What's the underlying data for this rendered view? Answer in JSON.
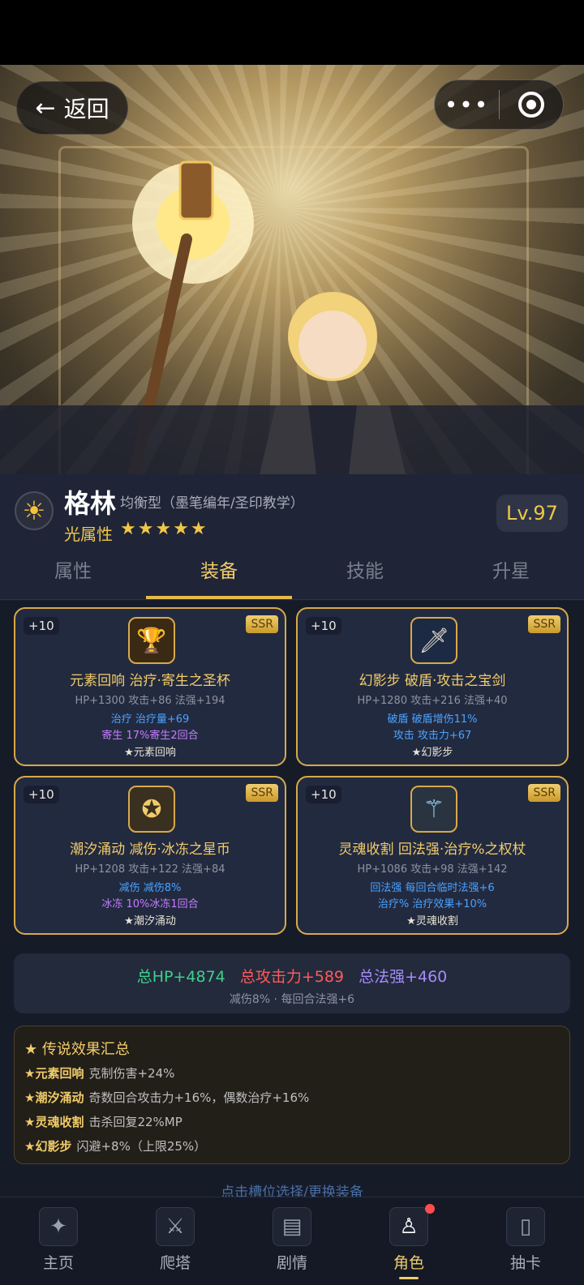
{
  "header": {
    "back_label": "返回",
    "more_dots": "•••"
  },
  "character": {
    "name": "格林",
    "subtype": "均衡型（墨笔编年/圣印教学）",
    "element": "光属性",
    "stars": "★★★★★",
    "level": "Lv.97"
  },
  "tabs": [
    "属性",
    "装备",
    "技能",
    "升星"
  ],
  "equipment": [
    {
      "plus": "+10",
      "rarity": "SSR",
      "title": "元素回响 治疗·寄生之圣杯",
      "stats": "HP+1300 攻击+86 法强+194",
      "fx1": "治疗 治疗量+69",
      "fx1_color": "#4aa3ff",
      "fx2": "寄生 17%寄生2回合",
      "fx2_color": "#c77dff",
      "legend": "★元素回响",
      "icon": "chalice-icon"
    },
    {
      "plus": "+10",
      "rarity": "SSR",
      "title": "幻影步 破盾·攻击之宝剑",
      "stats": "HP+1280 攻击+216 法强+40",
      "fx1": "破盾 破盾增伤11%",
      "fx1_color": "#4aa3ff",
      "fx2": "攻击 攻击力+67",
      "fx2_color": "#4aa3ff",
      "legend": "★幻影步",
      "icon": "sword-icon"
    },
    {
      "plus": "+10",
      "rarity": "SSR",
      "title": "潮汐涌动 减伤·冰冻之星币",
      "stats": "HP+1208 攻击+122 法强+84",
      "fx1": "减伤 减伤8%",
      "fx1_color": "#4aa3ff",
      "fx2": "冰冻 10%冰冻1回合",
      "fx2_color": "#c77dff",
      "legend": "★潮汐涌动",
      "icon": "star-coin-icon"
    },
    {
      "plus": "+10",
      "rarity": "SSR",
      "title": "灵魂收割 回法强·治疗%之权杖",
      "stats": "HP+1086 攻击+98 法强+142",
      "fx1": "回法强 每回合临时法强+6",
      "fx1_color": "#4aa3ff",
      "fx2": "治疗% 治疗效果+10%",
      "fx2_color": "#4aa3ff",
      "legend": "★灵魂收割",
      "icon": "scepter-icon"
    }
  ],
  "totals": {
    "hp": "总HP+4874",
    "atk": "总攻击力+589",
    "magic": "总法强+460",
    "sub": "减伤8% · 每回合法强+6",
    "hp_color": "#3fd08a",
    "atk_color": "#ff5a5a",
    "magic_color": "#a78bfa"
  },
  "legend": {
    "heading": "★ 传说效果汇总",
    "items": [
      {
        "name": "★元素回响",
        "desc": "克制伤害+24%"
      },
      {
        "name": "★潮汐涌动",
        "desc": "奇数回合攻击力+16%，偶数治疗+16%"
      },
      {
        "name": "★灵魂收割",
        "desc": "击杀回复22%MP"
      },
      {
        "name": "★幻影步",
        "desc": "闪避+8%（上限25%）"
      }
    ]
  },
  "hint": "点击槽位选择/更换装备",
  "nav": [
    {
      "label": "主页",
      "icon": "compass-icon"
    },
    {
      "label": "爬塔",
      "icon": "shield-swords-icon"
    },
    {
      "label": "剧情",
      "icon": "book-icon"
    },
    {
      "label": "角色",
      "icon": "hooded-figure-icon"
    },
    {
      "label": "抽卡",
      "icon": "card-icon"
    }
  ]
}
